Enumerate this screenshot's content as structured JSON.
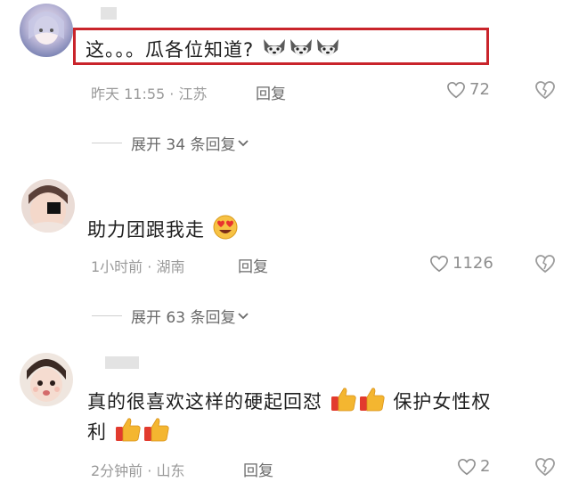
{
  "colors": {
    "highlight": "#c9242b",
    "meta": "#9a9a9a",
    "text": "#202020"
  },
  "comments": [
    {
      "text": "这。。。瓜各位知道?",
      "emojis": [
        "husky-emoji",
        "husky-emoji",
        "husky-emoji"
      ],
      "time_location": "昨天 11:55 · 江苏",
      "reply_label": "回复",
      "likes": "72",
      "expand_label": "展开 34 条回复"
    },
    {
      "text": "助力团跟我走",
      "emojis": [
        "heart-eyes-emoji"
      ],
      "time_location": "1小时前 · 湖南",
      "reply_label": "回复",
      "likes": "1126",
      "expand_label": "展开 63 条回复"
    },
    {
      "text_line1": "真的很喜欢这样的硬起回怼",
      "text_line1_after": "保护女性权",
      "text_line2": "利",
      "emojis": [
        "thumbs-up-emoji",
        "thumbs-up-emoji",
        "thumbs-up-emoji",
        "thumbs-up-emoji"
      ],
      "time_location": "2分钟前 · 山东",
      "reply_label": "回复",
      "likes": "2"
    }
  ]
}
